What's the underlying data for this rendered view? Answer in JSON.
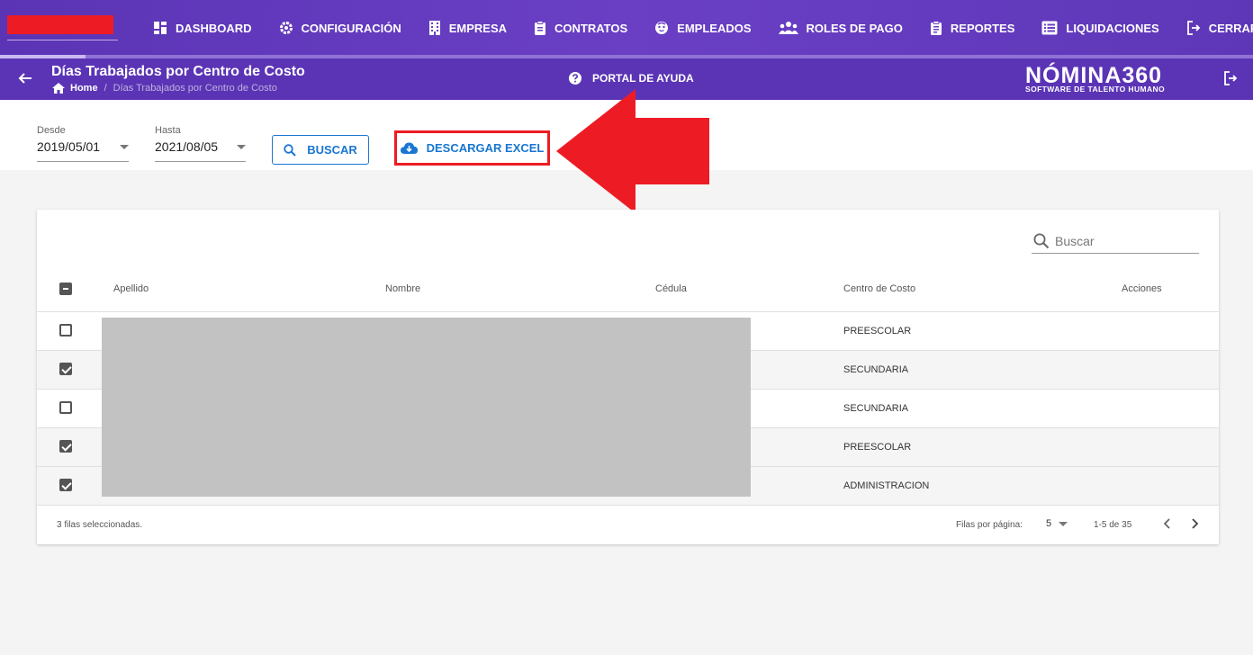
{
  "nav": {
    "items": [
      {
        "label": "DASHBOARD",
        "icon": "dashboard-icon"
      },
      {
        "label": "CONFIGURACIÓN",
        "icon": "gear-icon"
      },
      {
        "label": "EMPRESA",
        "icon": "building-icon"
      },
      {
        "label": "CONTRATOS",
        "icon": "clipboard-icon"
      },
      {
        "label": "EMPLEADOS",
        "icon": "face-icon"
      },
      {
        "label": "ROLES DE PAGO",
        "icon": "people-icon"
      },
      {
        "label": "REPORTES",
        "icon": "report-icon"
      },
      {
        "label": "LIQUIDACIONES",
        "icon": "list-icon"
      },
      {
        "label": "CERRAR SESIÓN",
        "icon": "logout-icon"
      }
    ],
    "progress": 0.068
  },
  "header": {
    "title": "Días Trabajados por Centro de Costo",
    "breadcrumb_home": "Home",
    "breadcrumb_current": "Días Trabajados por Centro de Costo",
    "help": "PORTAL DE AYUDA",
    "logo_main": "NÓMINA360",
    "logo_sub": "SOFTWARE DE TALENTO HUMANO"
  },
  "filters": {
    "desde_label": "Desde",
    "desde_value": "2019/05/01",
    "hasta_label": "Hasta",
    "hasta_value": "2021/08/05",
    "buscar_label": "BUSCAR",
    "excel_label": "DESCARGAR EXCEL"
  },
  "table": {
    "search_placeholder": "Buscar",
    "columns": [
      "Apellido",
      "Nombre",
      "Cédula",
      "Centro de Costo",
      "Acciones"
    ],
    "rows": [
      {
        "centro": "PREESCOLAR",
        "checked": false
      },
      {
        "centro": "SECUNDARIA",
        "checked": true
      },
      {
        "centro": "SECUNDARIA",
        "checked": false
      },
      {
        "centro": "PREESCOLAR",
        "checked": true
      },
      {
        "centro": "ADMINISTRACION",
        "checked": true
      }
    ],
    "selected_text": "3 filas seleccionadas.",
    "rows_per_page_label": "Filas por página:",
    "rows_per_page_value": "5",
    "range": "1-5 de 35"
  },
  "colors": {
    "primary": "#5b34b5",
    "accent": "#1976d2",
    "highlight": "#ed1c24"
  }
}
